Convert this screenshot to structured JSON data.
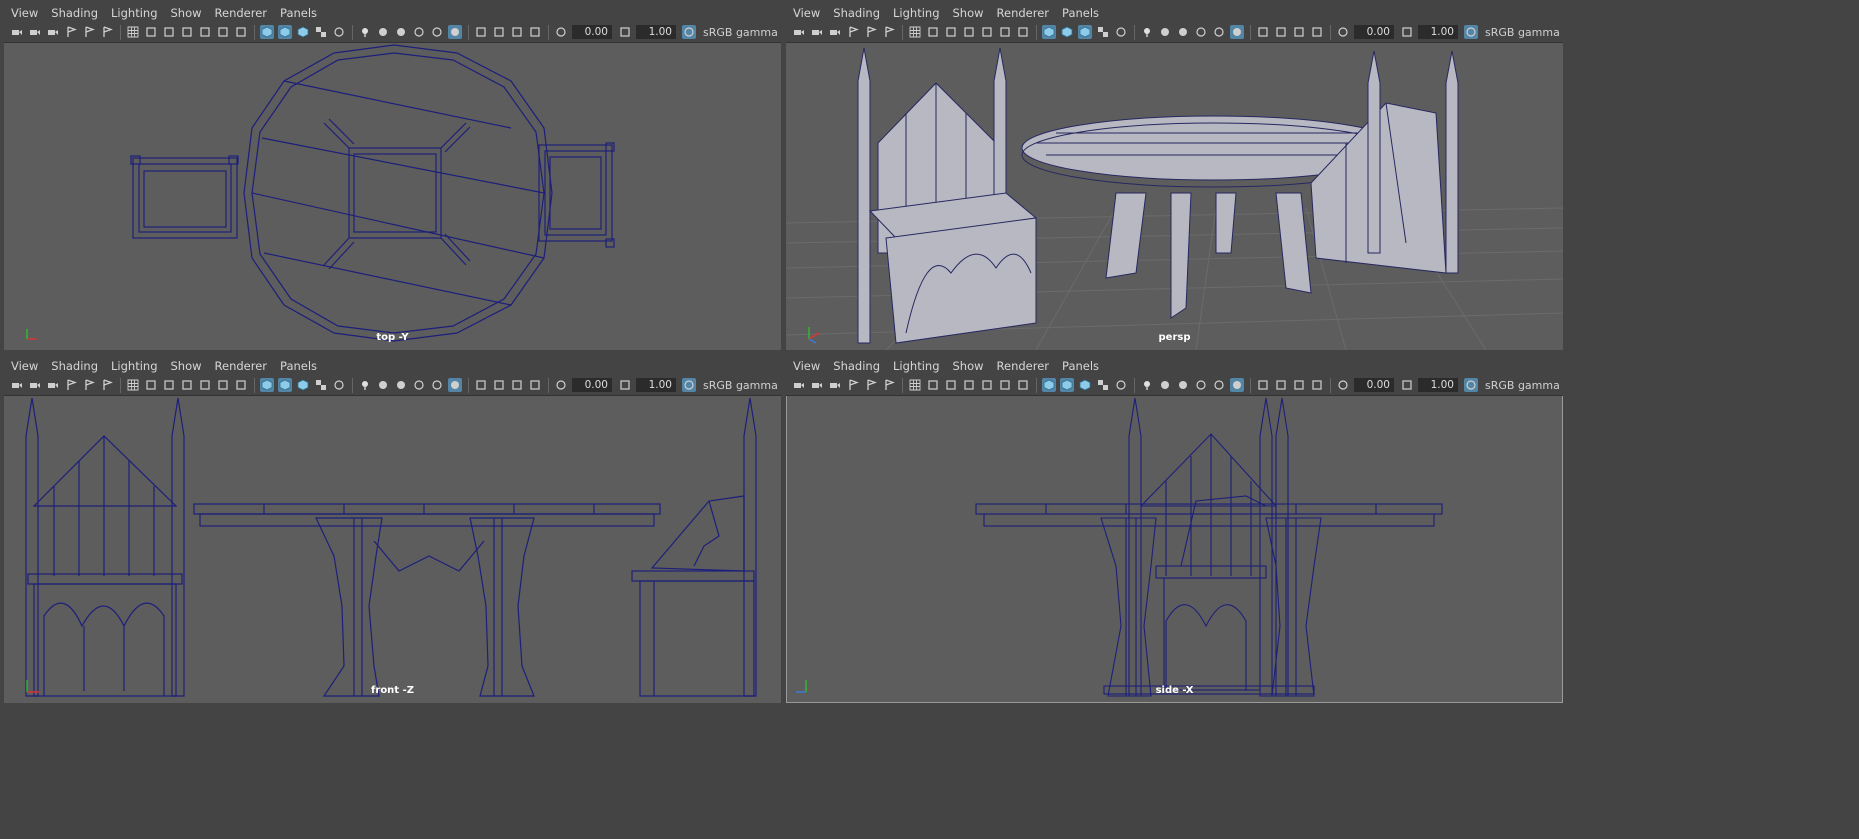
{
  "menu": [
    "View",
    "Shading",
    "Lighting",
    "Show",
    "Renderer",
    "Panels"
  ],
  "toolbar": {
    "exposure": "0.00",
    "gamma": "1.00",
    "colorspace": "sRGB gamma"
  },
  "panels": [
    {
      "camera": "top -Y"
    },
    {
      "camera": "persp"
    },
    {
      "camera": "front -Z"
    },
    {
      "camera": "side -X"
    }
  ],
  "colors": {
    "viewport": "#5d5d5d",
    "wire": "#1d1f7a",
    "accent": "#5285a6",
    "chrome": "#444444"
  },
  "icons": [
    "camera-select-icon",
    "camera-attributes-icon",
    "bookmark-icon",
    "image-plane-icon",
    "2d-pan-zoom-icon",
    "grease-pencil-icon",
    "grid-icon",
    "film-gate-icon",
    "resolution-gate-icon",
    "gate-mask-icon",
    "field-chart-icon",
    "safe-action-icon",
    "safe-title-icon",
    "wireframe-icon",
    "smooth-shade-icon",
    "default-material-icon",
    "textured-icon",
    "xray-icon",
    "lights-icon",
    "shadows-icon",
    "screen-space-ao-icon",
    "motion-blur-icon",
    "anti-alias-icon",
    "depth-of-field-icon",
    "isolate-select-icon",
    "xray-joints-icon",
    "xray-active-icon",
    "backface-cull-icon",
    "exposure-icon",
    "gamma-icon",
    "color-management-icon"
  ]
}
